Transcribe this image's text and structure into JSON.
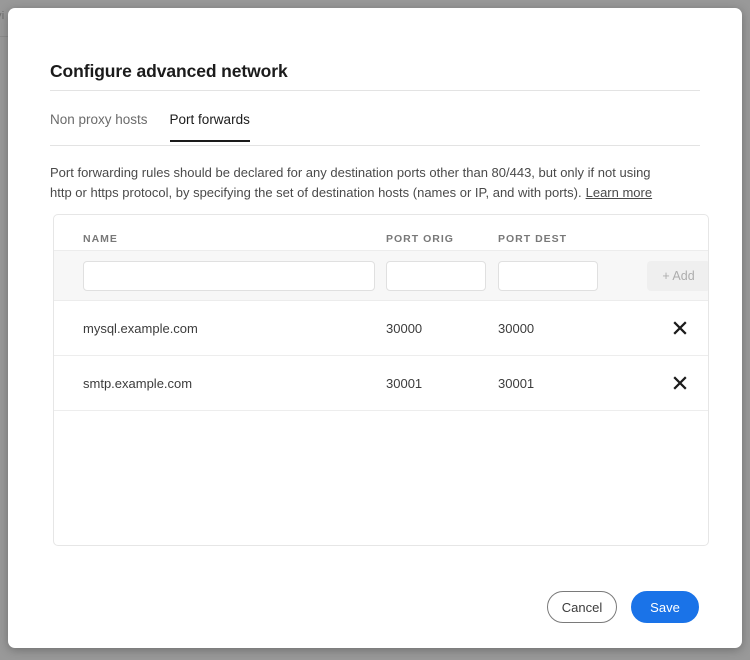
{
  "backdrop": {
    "clipped_text": "vi"
  },
  "dialog": {
    "title": "Configure advanced network",
    "tabs": [
      {
        "label": "Non proxy hosts",
        "active": false
      },
      {
        "label": "Port forwards",
        "active": true
      }
    ],
    "description": "Port forwarding rules should be declared for any destination ports other than 80/443, but only if not using http or https protocol, by specifying the set of destination hosts (names or IP, and with ports).",
    "learn_more_label": "Learn more"
  },
  "table": {
    "headers": {
      "name": "NAME",
      "port_orig": "PORT ORIG",
      "port_dest": "PORT DEST"
    },
    "new_row": {
      "name_value": "",
      "name_placeholder": "",
      "port_orig_value": "",
      "port_orig_placeholder": "",
      "port_dest_value": "",
      "port_dest_placeholder": "",
      "add_label": "+ Add",
      "add_enabled": false
    },
    "rows": [
      {
        "name": "mysql.example.com",
        "port_orig": "30000",
        "port_dest": "30000",
        "delete_icon": "close-icon"
      },
      {
        "name": "smtp.example.com",
        "port_orig": "30001",
        "port_dest": "30001",
        "delete_icon": "close-icon"
      }
    ]
  },
  "footer": {
    "cancel_label": "Cancel",
    "save_label": "Save"
  },
  "colors": {
    "accent": "#1a73e8",
    "backdrop": "#999999",
    "dialog_bg": "#ffffff",
    "text_primary": "#1b1b1b",
    "text_secondary": "#6b6b6b",
    "header_text": "#787878",
    "border": "#e6e6e6",
    "input_row_bg": "#f7f7f7",
    "add_button_bg": "#efefef",
    "add_button_text": "#adadad"
  }
}
